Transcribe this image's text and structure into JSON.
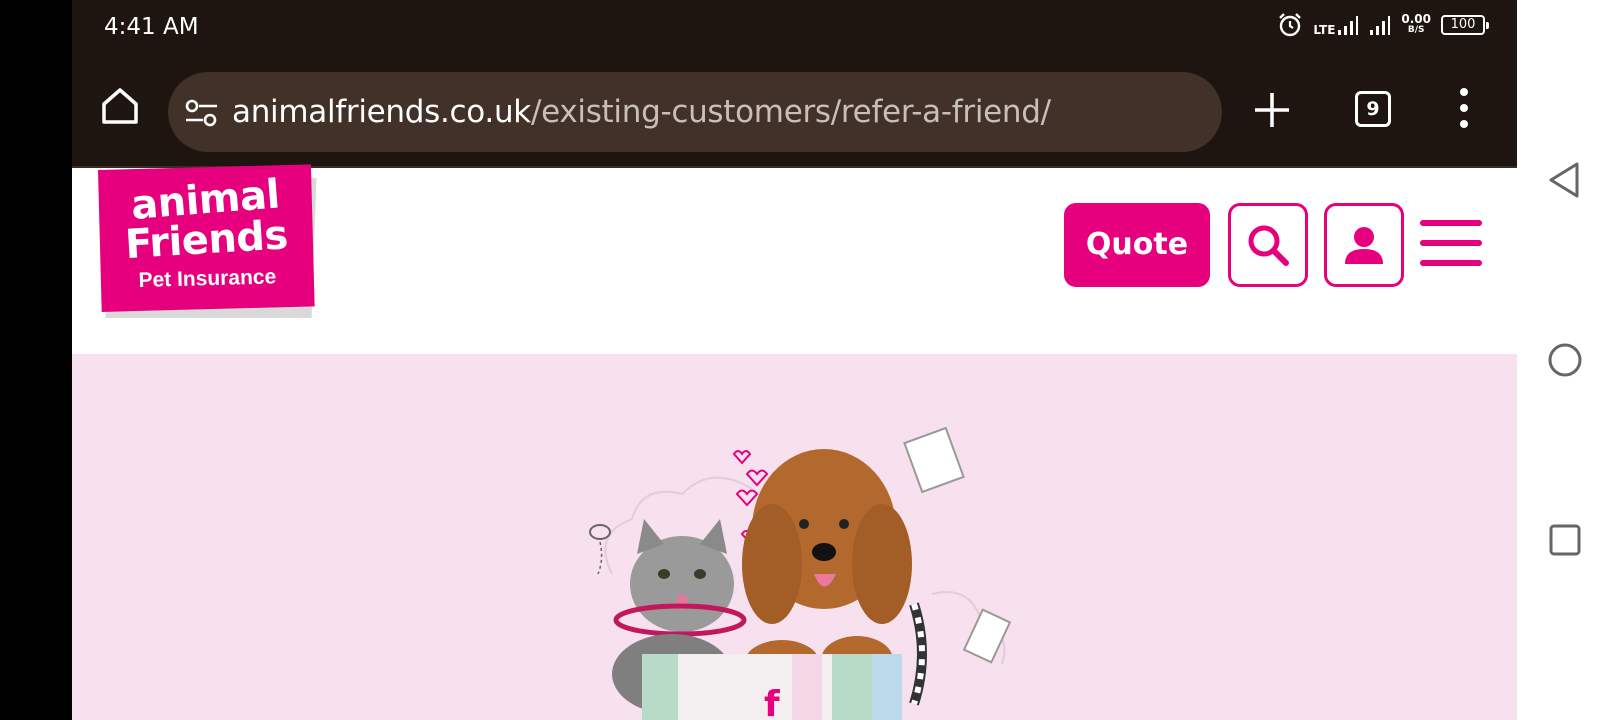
{
  "status_bar": {
    "time": "4:41 AM",
    "network_label": "LTE",
    "speed_value": "0.00",
    "speed_unit": "B/S",
    "battery": "100",
    "icons": [
      "alarm-icon",
      "signal-icon",
      "signal-icon",
      "battery-icon"
    ]
  },
  "browser": {
    "url_domain": "animalfriends.co.uk",
    "url_path": "/existing-customers/refer-a-friend/",
    "tab_count": "9",
    "icons": [
      "home-icon",
      "site-settings-icon",
      "plus-icon",
      "more-vert-icon"
    ]
  },
  "site": {
    "logo": {
      "line1": "animal",
      "line2": "Friends",
      "line3": "Pet Insurance"
    },
    "quote_label": "Quote",
    "brand_color": "#e6007e",
    "icons": [
      "search-icon",
      "user-icon",
      "hamburger-icon"
    ]
  },
  "hero": {
    "background_color": "#f7e1ee",
    "image_subject": "cat with cone collar and fluffy dog in gift bag with hearts"
  },
  "android_nav": {
    "icons": [
      "back-icon",
      "home-circle-icon",
      "recents-icon"
    ]
  }
}
